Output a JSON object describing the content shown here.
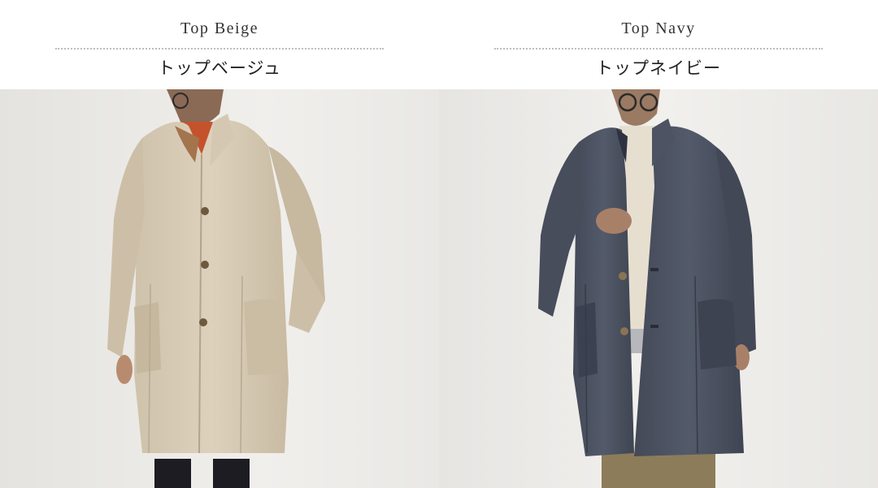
{
  "products": [
    {
      "name_en": "Top Beige",
      "name_ja": "トップベージュ",
      "photo_icon": "beige-wool-coat-photo",
      "colors": {
        "coat": "#d8cbb6",
        "coat_shadow": "#bfae94",
        "background": "#ecebe8",
        "sweater": "#c4532c",
        "trousers": "#1c1c22"
      }
    },
    {
      "name_en": "Top Navy",
      "name_ja": "トップネイビー",
      "photo_icon": "navy-wool-coat-photo",
      "colors": {
        "coat": "#4a505f",
        "coat_shadow": "#363b48",
        "background": "#edecea",
        "sweater": "#e6dfcf",
        "trousers": "#8c7c5a"
      }
    }
  ]
}
